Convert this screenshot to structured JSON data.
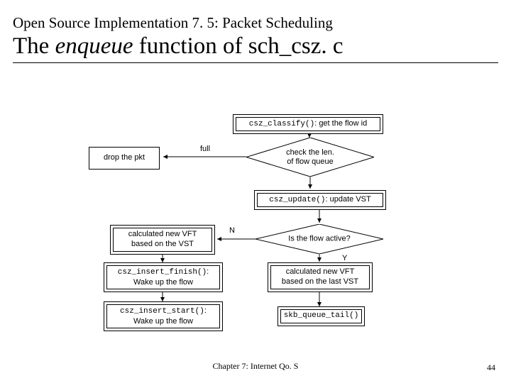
{
  "header": {
    "subtitle": "Open Source Implementation 7. 5: Packet Scheduling",
    "title_pre": "The ",
    "title_em": "enqueue",
    "title_post": " function of sch_csz. c"
  },
  "boxes": {
    "classify_code": "csz_classify()",
    "classify_text": ": get the flow id",
    "drop": "drop the pkt",
    "check_l1": "check the len.",
    "check_l2": "of flow queue",
    "update_code": "csz_update()",
    "update_text": ": update VST",
    "vft_vst_l1": "calculated new VFT",
    "vft_vst_l2": "based on the VST",
    "active_q": "Is the flow active?",
    "vft_last_l1": "calculated new VFT",
    "vft_last_l2": "based on the last VST",
    "finish_code": "csz_insert_finish()",
    "finish_text_l2": "Wake up the flow",
    "start_code": "csz_insert_start()",
    "start_text_l2": "Wake up the flow",
    "skb": "skb_queue_tail()"
  },
  "labels": {
    "full": "full",
    "N": "N",
    "Y": "Y"
  },
  "footer": {
    "chapter": "Chapter 7: Internet Qo. S",
    "page": "44"
  }
}
